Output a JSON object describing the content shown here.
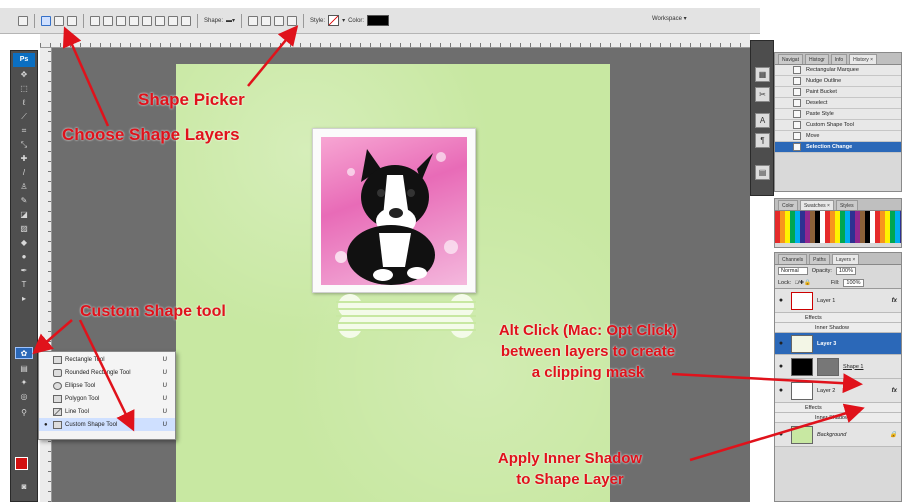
{
  "options_bar": {
    "shape_label": "Shape:",
    "style_label": "Style:",
    "color_label": "Color:",
    "workspace_label": "Workspace ▾"
  },
  "toolbox": {
    "logo": "Ps",
    "foreground_color": "#d21010",
    "background_color": "#000000"
  },
  "shape_tool_flyout": {
    "items": [
      {
        "label": "Rectangle Tool",
        "key": "U"
      },
      {
        "label": "Rounded Rectangle Tool",
        "key": "U"
      },
      {
        "label": "Ellipse Tool",
        "key": "U"
      },
      {
        "label": "Polygon Tool",
        "key": "U"
      },
      {
        "label": "Line Tool",
        "key": "U"
      },
      {
        "label": "Custom Shape Tool",
        "key": "U",
        "selected": true
      }
    ]
  },
  "history_panel": {
    "tabs": [
      "Navigat",
      "Histogr",
      "Info",
      "History ×"
    ],
    "items": [
      {
        "label": "Rectangular Marquee"
      },
      {
        "label": "Nudge Outline"
      },
      {
        "label": "Paint Bucket"
      },
      {
        "label": "Deselect"
      },
      {
        "label": "Paste Style"
      },
      {
        "label": "Custom Shape Tool"
      },
      {
        "label": "Move"
      },
      {
        "label": "Selection Change",
        "selected": true
      }
    ]
  },
  "color_panel": {
    "tabs": [
      "Color",
      "Swatches ×",
      "Styles"
    ]
  },
  "layers_panel": {
    "tabs": [
      "Channels",
      "Paths",
      "Layers ×"
    ],
    "blend_mode": "Normal",
    "opacity_label": "Opacity:",
    "opacity_value": "100%",
    "lock_label": "Lock:",
    "fill_label": "Fill:",
    "fill_value": "100%",
    "layers": [
      {
        "name": "Layer 1",
        "fx": "fx"
      },
      {
        "name": "Effects",
        "sub": true
      },
      {
        "name": "Inner Shadow",
        "sub": true
      },
      {
        "name": "Layer 3",
        "selected": true
      },
      {
        "name": "Shape 1"
      },
      {
        "name": "Layer 2",
        "fx": "fx"
      },
      {
        "name": "Effects",
        "sub": true
      },
      {
        "name": "Inner Shadow",
        "sub": true
      },
      {
        "name": "Background"
      }
    ]
  },
  "annotations": {
    "shape_picker": "Shape Picker",
    "choose_shape_layers": "Choose Shape Layers",
    "custom_shape_tool": "Custom Shape tool",
    "alt_click_line1": "Alt Click (Mac: Opt Click)",
    "alt_click_line2": "between layers to create",
    "alt_click_line3": "a clipping mask",
    "inner_shadow_line1": "Apply Inner Shadow",
    "inner_shadow_line2": "to Shape Layer"
  },
  "colors": {
    "annotation_red": "#e0121b",
    "canvas_green": "#c8e8a2",
    "selection_blue": "#2b68b8"
  }
}
